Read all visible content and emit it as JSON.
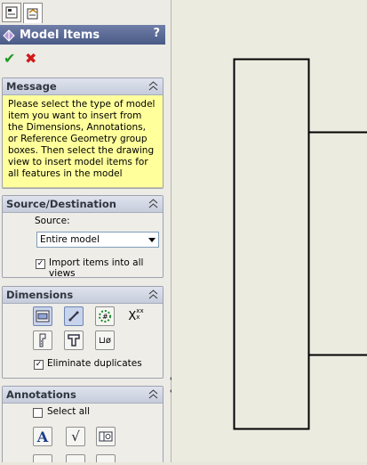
{
  "panel": {
    "title": "Model Items",
    "help": "?",
    "ok_glyph": "✔",
    "cancel_glyph": "✖",
    "tabs": [
      {
        "icon": "feature-manager-icon"
      },
      {
        "icon": "property-manager-icon"
      }
    ]
  },
  "message": {
    "header": "Message",
    "text": "Please select the type of model item you want to insert from the Dimensions, Annotations, or Reference Geometry group boxes. Then select the drawing view to insert model items for all features in the model"
  },
  "source": {
    "header": "Source/Destination",
    "label": "Source:",
    "value": "Entire model",
    "import_label": "Import items into all views",
    "import_checked": true
  },
  "dimensions": {
    "header": "Dimensions",
    "buttons": [
      {
        "icon": "marked-for-drawing-icon",
        "active": true
      },
      {
        "icon": "not-marked-for-drawing-icon",
        "active": true
      },
      {
        "icon": "instance-count-icon",
        "active": false
      },
      {
        "icon": "tolerance-dimensions-icon",
        "text": "X",
        "active": false
      },
      {
        "icon": "hole-wizard-profiles-icon",
        "active": false
      },
      {
        "icon": "hole-wizard-locations-icon",
        "active": false
      },
      {
        "icon": "hole-callout-icon",
        "text": "⊔ø",
        "active": false
      }
    ],
    "eliminate_label": "Eliminate duplicates",
    "eliminate_checked": true
  },
  "annotations": {
    "header": "Annotations",
    "select_all_label": "Select all",
    "select_all_checked": false,
    "buttons": [
      {
        "icon": "note-icon",
        "text": "A"
      },
      {
        "icon": "surface-finish-icon",
        "text": "√"
      },
      {
        "icon": "geometric-tolerance-icon"
      }
    ]
  },
  "colors": {
    "title_bar": "#4a5a86",
    "message_bg": "#ffff9c",
    "ok": "#1f9a1f",
    "cancel": "#d11a1a"
  }
}
